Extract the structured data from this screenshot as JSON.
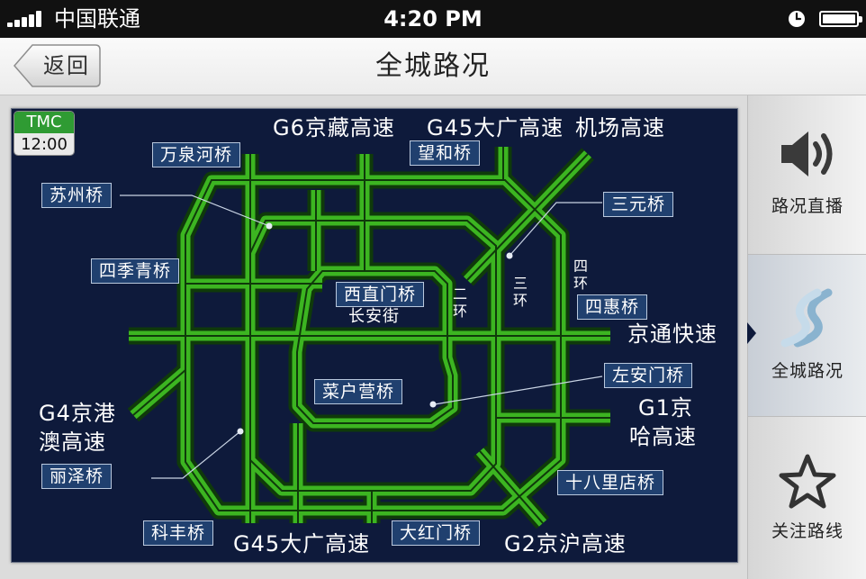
{
  "status_bar": {
    "carrier": "中国联通",
    "time": "4:20 PM",
    "icons": [
      "signal-icon",
      "alarm-icon",
      "battery-icon"
    ]
  },
  "nav": {
    "back_label": "返回",
    "title": "全城路况"
  },
  "map": {
    "tmc": {
      "label": "TMC",
      "time": "12:00"
    },
    "roads": {
      "g6": "G6京藏高速",
      "g45_north": "G45大广高速",
      "airport": "机场高速",
      "jingtong": "京通快速",
      "g4_line1": "G4京港",
      "g4_line2": "澳高速",
      "g1_line1": "G1京",
      "g1_line2": "哈高速",
      "g45_south": "G45大广高速",
      "g2": "G2京沪高速"
    },
    "rings": {
      "second": [
        "二",
        "环"
      ],
      "third": [
        "三",
        "环"
      ],
      "fourth": [
        "四",
        "环"
      ]
    },
    "street": "长安街",
    "bridges": {
      "wanquanhe": "万泉河桥",
      "wanghe": "望和桥",
      "suzhou": "苏州桥",
      "sanyuan": "三元桥",
      "siji": "四季青桥",
      "xizhimen": "西直门桥",
      "sihui": "四惠桥",
      "zuoanmen": "左安门桥",
      "caihuying": "菜户营桥",
      "lize": "丽泽桥",
      "shibalidian": "十八里店桥",
      "kefeng": "科丰桥",
      "dahongmen": "大红门桥"
    },
    "road_color": "#3cb521",
    "road_edge_color": "#0f3a0a",
    "background_color": "#0e1a3b"
  },
  "tabs": [
    {
      "label": "路况直播",
      "icon": "speaker-icon",
      "active": false
    },
    {
      "label": "全城路况",
      "icon": "road-curve-icon",
      "active": true
    },
    {
      "label": "关注路线",
      "icon": "star-icon",
      "active": false
    }
  ]
}
